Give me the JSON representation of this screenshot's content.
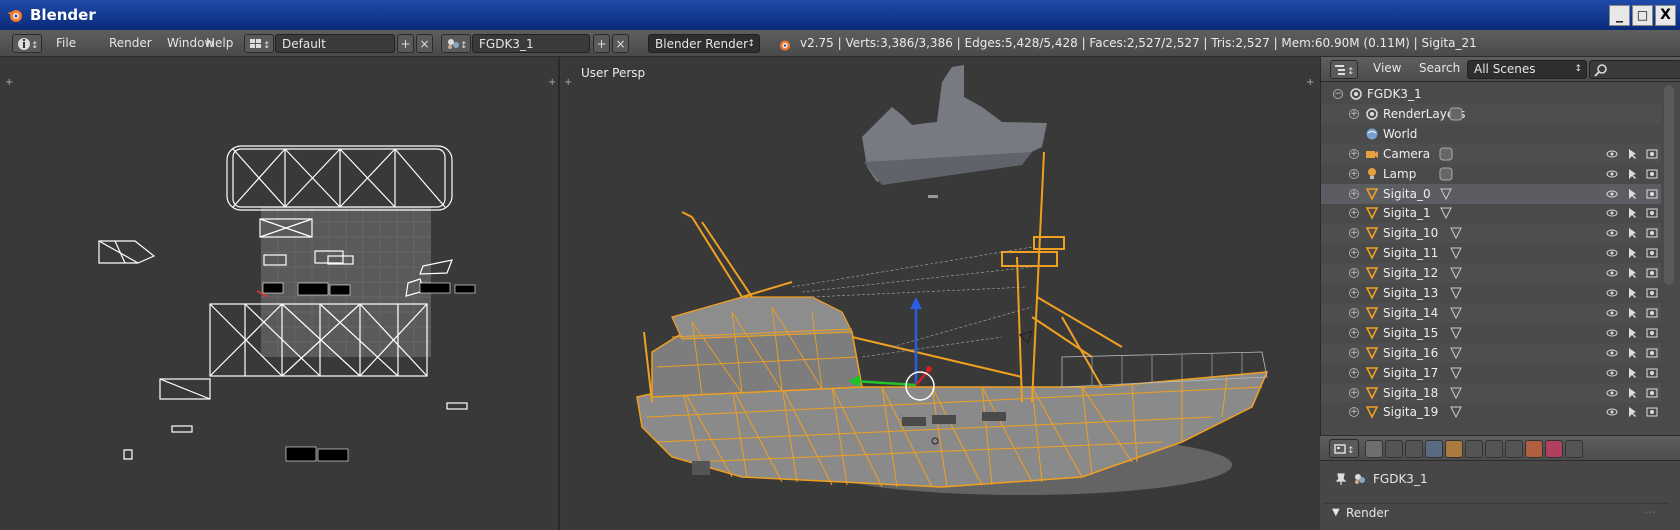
{
  "window": {
    "title": "Blender",
    "min_label": "_",
    "max_label": "□",
    "close_label": "X"
  },
  "menubar": {
    "info_icon": "info-icon",
    "menus": [
      "File",
      "Render",
      "Window",
      "Help"
    ],
    "layout_name": "Default",
    "scene_name": "FGDK3_1",
    "render_engine": "Blender Render",
    "stats": "v2.75 | Verts:3,386/3,386 | Edges:5,428/5,428 | Faces:2,527/2,527 | Tris:2,527 | Mem:60.90M (0.11M) | Sigita_21"
  },
  "viewport": {
    "label": "User Persp"
  },
  "outliner": {
    "view_label": "View",
    "search_label": "Search",
    "scene_filter": "All Scenes",
    "rows": [
      {
        "label": "FGDK3_1",
        "type": "scene"
      },
      {
        "label": "RenderLayers",
        "type": "renderlayers"
      },
      {
        "label": "World",
        "type": "world"
      },
      {
        "label": "Camera",
        "type": "camera"
      },
      {
        "label": "Lamp",
        "type": "lamp"
      },
      {
        "label": "Sigita_0",
        "type": "mesh"
      },
      {
        "label": "Sigita_1",
        "type": "mesh"
      },
      {
        "label": "Sigita_10",
        "type": "mesh"
      },
      {
        "label": "Sigita_11",
        "type": "mesh"
      },
      {
        "label": "Sigita_12",
        "type": "mesh"
      },
      {
        "label": "Sigita_13",
        "type": "mesh"
      },
      {
        "label": "Sigita_14",
        "type": "mesh"
      },
      {
        "label": "Sigita_15",
        "type": "mesh"
      },
      {
        "label": "Sigita_16",
        "type": "mesh"
      },
      {
        "label": "Sigita_17",
        "type": "mesh"
      },
      {
        "label": "Sigita_18",
        "type": "mesh"
      },
      {
        "label": "Sigita_19",
        "type": "mesh"
      }
    ]
  },
  "properties": {
    "context_label": "FGDK3_1",
    "panel_label": "Render"
  },
  "colors": {
    "selection_orange": "#f0a020",
    "titlebar": "#1f4aa8",
    "background": "#393939"
  }
}
